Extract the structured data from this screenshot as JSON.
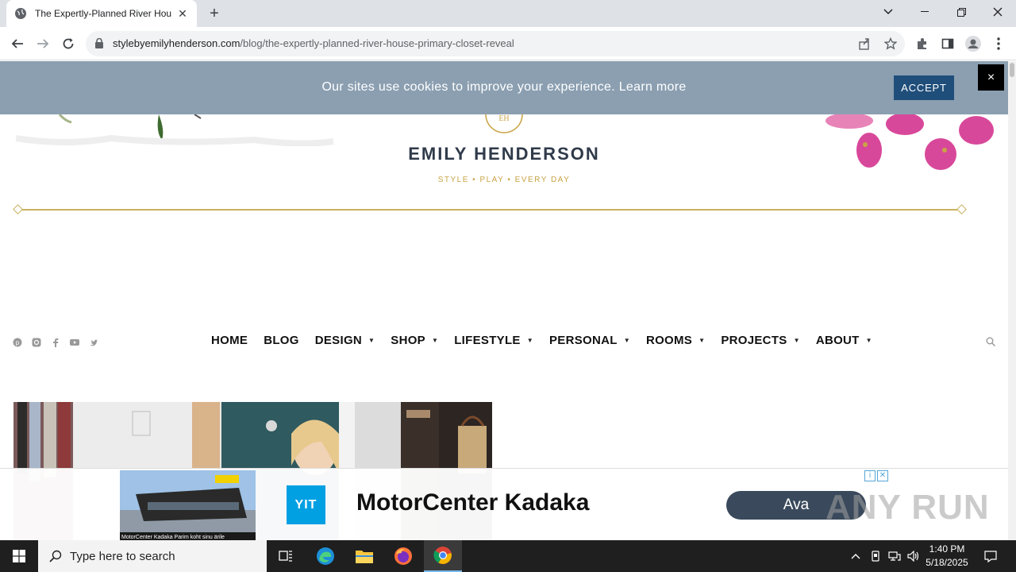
{
  "browser": {
    "tab_title": "The Expertly-Planned River House",
    "new_tab_label": "+",
    "url_host": "stylebyemilyhenderson.com",
    "url_path": "/blog/the-expertly-planned-river-house-primary-closet-reveal"
  },
  "cookie": {
    "message": "Our sites use cookies to improve your experience.",
    "learn_more": "Learn more",
    "accept": "ACCEPT",
    "close": "×"
  },
  "site": {
    "brand": "EMILY HENDERSON",
    "tagline": "STYLE   •   PLAY   •   EVERY DAY",
    "accent_color": "#c9a445"
  },
  "nav": {
    "items": [
      {
        "label": "HOME",
        "has_menu": false
      },
      {
        "label": "BLOG",
        "has_menu": false
      },
      {
        "label": "DESIGN",
        "has_menu": true
      },
      {
        "label": "SHOP",
        "has_menu": true
      },
      {
        "label": "LIFESTYLE",
        "has_menu": true
      },
      {
        "label": "PERSONAL",
        "has_menu": true
      },
      {
        "label": "ROOMS",
        "has_menu": true
      },
      {
        "label": "PROJECTS",
        "has_menu": true
      },
      {
        "label": "ABOUT",
        "has_menu": true
      }
    ],
    "social_icons": [
      "pinterest-icon",
      "instagram-icon",
      "facebook-icon",
      "youtube-icon",
      "twitter-icon"
    ]
  },
  "ad": {
    "logo": "YIT",
    "title": "MotorCenter Kadaka",
    "cta": "Ava",
    "image_caption": "MotorCenter Kadaka  Parim koht sinu ärile",
    "watermark": "ANY RUN"
  },
  "taskbar": {
    "search_placeholder": "Type here to search",
    "time": "1:40 PM",
    "date": "5/18/2025"
  }
}
